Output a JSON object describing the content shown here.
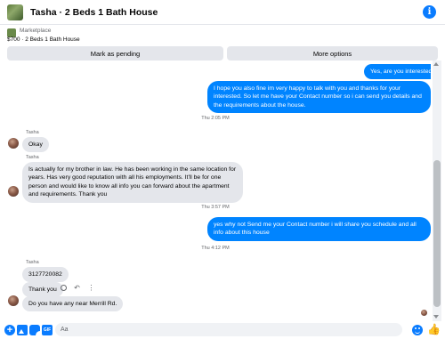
{
  "header": {
    "title": "Tasha · 2 Beds 1 Bath House",
    "info_icon": "i"
  },
  "listing": {
    "source": "Marketplace",
    "price_title": "$700 · 2 Beds 1 Bath House",
    "mark_pending_label": "Mark as pending",
    "more_options_label": "More options"
  },
  "messages": {
    "m1": "Yes, are you interested?",
    "m2": "I hope you also fine im very happy to talk with you and thanks for your interested. So let me have your Contact number so i can send you details and the requirements about the house.",
    "t1": "Thu 2:05 PM",
    "s1": "Tasha",
    "m3": "Okay",
    "s2": "Tasha",
    "m4": "Is actually for my brother in law. He has been working in the same location for years. Has very good reputation with all his employments. It'll be for one person and would like to know all info you can forward about the apartment and requirements. Thank you",
    "t2": "Thu 3:57 PM",
    "m5": "yes why not Send me your Contact number i will share you schedule and all info about this house",
    "t3": "Thu 4:12 PM",
    "s3": "Tasha",
    "m6": "3127720082",
    "m7": "Thank you",
    "m8": "Do you have any near Merrill Rd."
  },
  "composer": {
    "placeholder": "Aa",
    "plus_icon": "+",
    "gif_label": "GIF",
    "like_icon": "👍"
  },
  "colors": {
    "accent": "#0084ff",
    "incoming_bubble": "#e4e6eb",
    "muted_text": "#65676b"
  }
}
